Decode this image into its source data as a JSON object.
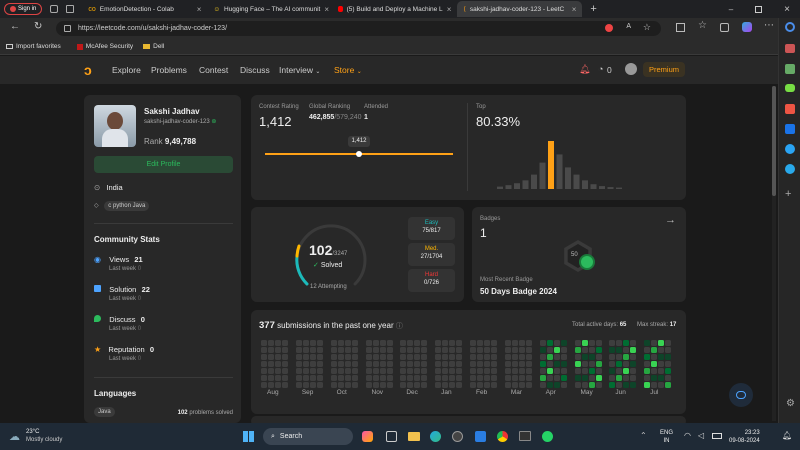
{
  "browser": {
    "profile_label": "Sign in",
    "tabs": [
      {
        "label": "EmotionDetection - Colab"
      },
      {
        "label": "Hugging Face – The AI communit"
      },
      {
        "label": "(5) Build and Deploy a Machine L"
      },
      {
        "label": "sakshi-jadhav-coder-123 - LeetC"
      }
    ],
    "url": "https://leetcode.com/u/sakshi-jadhav-coder-123/",
    "favorites": [
      "Import favorites",
      "McAfee Security",
      "Dell"
    ]
  },
  "nav": {
    "items": [
      "Explore",
      "Problems",
      "Contest",
      "Discuss",
      "Interview",
      "Store"
    ],
    "coins": "0",
    "premium_label": "Premium"
  },
  "profile": {
    "name": "Sakshi Jadhav",
    "username": "sakshi-jadhav-coder-123",
    "rank_label": "Rank",
    "rank": "9,49,788",
    "edit_label": "Edit Profile",
    "location": "India",
    "skills": "c python Java"
  },
  "community": {
    "title": "Community Stats",
    "items": [
      {
        "label": "Views",
        "value": "21",
        "sub": "Last week",
        "sub_value": "0",
        "color": "#4da3ff"
      },
      {
        "label": "Solution",
        "value": "22",
        "sub": "Last week",
        "sub_value": "0",
        "color": "#4da3ff"
      },
      {
        "label": "Discuss",
        "value": "0",
        "sub": "Last week",
        "sub_value": "0",
        "color": "#2cbb5d"
      },
      {
        "label": "Reputation",
        "value": "0",
        "sub": "Last week",
        "sub_value": "0",
        "color": "#ffa116"
      }
    ]
  },
  "languages": {
    "title": "Languages",
    "items": [
      {
        "name": "Java",
        "count": "102",
        "suffix": "problems solved"
      }
    ]
  },
  "contest": {
    "rating_label": "Contest Rating",
    "rating": "1,412",
    "global_label": "Global Ranking",
    "global_rank": "462,855",
    "global_total": "/579,240",
    "attended_label": "Attended",
    "attended": "1",
    "tooltip": "1,412",
    "top_label": "Top",
    "top_value": "80.33%",
    "histogram": [
      0.05,
      0.08,
      0.12,
      0.18,
      0.3,
      0.55,
      1.0,
      0.72,
      0.45,
      0.3,
      0.18,
      0.1,
      0.06,
      0.04,
      0.03
    ],
    "highlight_index": 6
  },
  "solved": {
    "count": "102",
    "total": "/3247",
    "solved_label": "Solved",
    "attempting": "12 Attempting",
    "easy_label": "Easy",
    "easy": "75/817",
    "med_label": "Med.",
    "med": "27/1704",
    "hard_label": "Hard",
    "hard": "0/726",
    "easy_color": "#1cbaba",
    "med_color": "#ffb700",
    "hard_color": "#f63737"
  },
  "badges": {
    "label": "Badges",
    "count": "1",
    "recent_label": "Most Recent Badge",
    "recent_name": "50 Days Badge 2024",
    "badge_text": "50"
  },
  "submissions": {
    "count": "377",
    "label": "submissions in the past one year",
    "active_label": "Total active days:",
    "active_days": "65",
    "streak_label": "Max streak:",
    "streak": "17",
    "months": [
      "Aug",
      "Sep",
      "Oct",
      "Nov",
      "Dec",
      "Jan",
      "Feb",
      "Mar",
      "Apr",
      "May",
      "Jun",
      "Jul"
    ]
  },
  "taskbar": {
    "temp": "23°C",
    "weather": "Mostly cloudy",
    "search": "Search",
    "lang1": "ENG",
    "lang2": "IN",
    "time": "23:23",
    "date": "09-08-2024"
  }
}
